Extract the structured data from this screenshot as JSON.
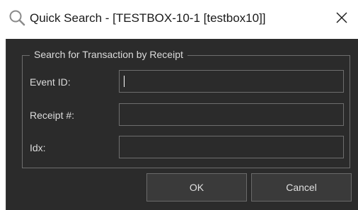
{
  "window": {
    "title": "Quick Search - [TESTBOX-10-1 [testbox10]]",
    "icon": "search-icon",
    "close_icon": "close-icon"
  },
  "group": {
    "legend": "Search for Transaction by Receipt"
  },
  "fields": [
    {
      "label": "Event ID:",
      "value": "",
      "placeholder": ""
    },
    {
      "label": "Receipt #:",
      "value": "",
      "placeholder": ""
    },
    {
      "label": "Idx:",
      "value": "",
      "placeholder": ""
    }
  ],
  "buttons": {
    "ok_label": "OK",
    "cancel_label": "Cancel"
  },
  "colors": {
    "dialog_background": "#2b2b2b",
    "border": "#6e6e6e",
    "text": "#dcdcdc",
    "titlebar": "#ffffff"
  }
}
